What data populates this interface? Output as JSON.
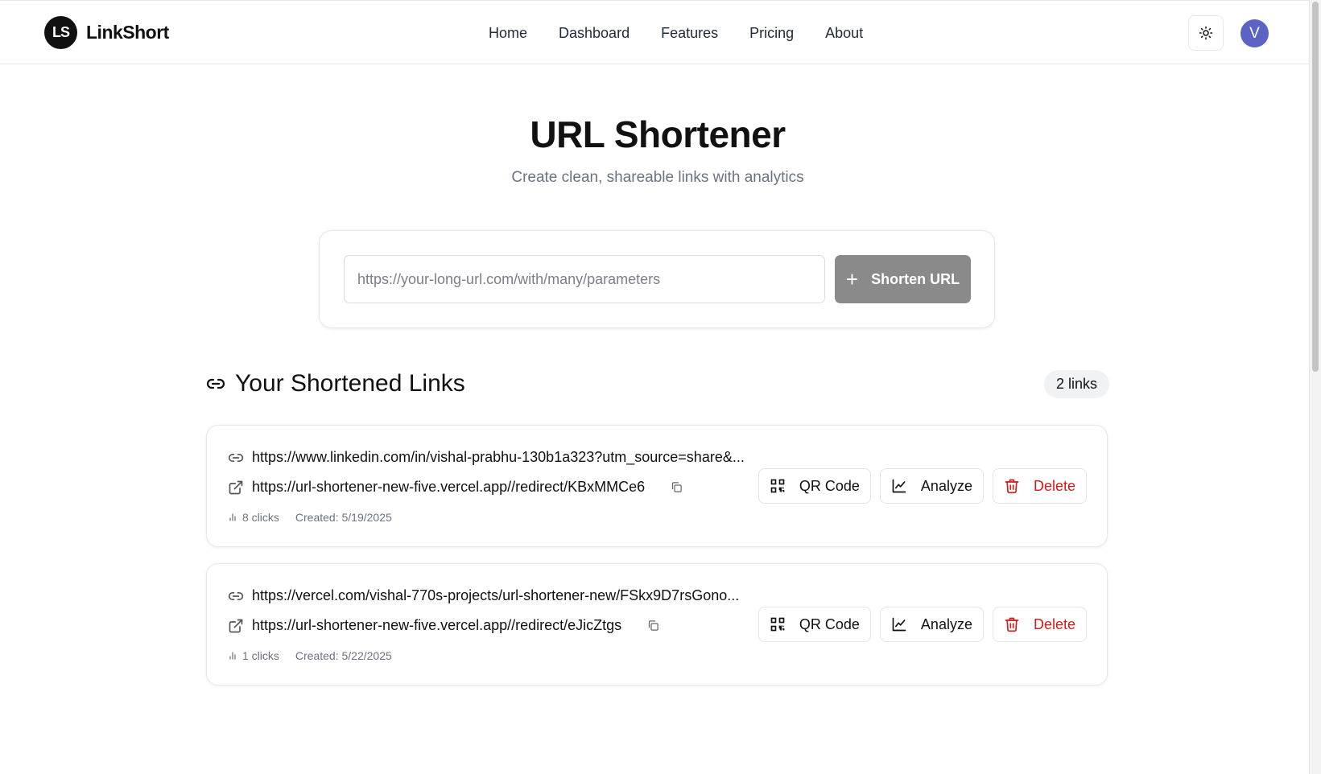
{
  "header": {
    "logo_text": "LS",
    "brand": "LinkShort",
    "nav": [
      "Home",
      "Dashboard",
      "Features",
      "Pricing",
      "About"
    ],
    "avatar_initial": "V"
  },
  "hero": {
    "title": "URL Shortener",
    "subtitle": "Create clean, shareable links with analytics"
  },
  "shorten": {
    "placeholder": "https://your-long-url.com/with/many/parameters",
    "value": "",
    "button_label": "Shorten URL"
  },
  "links_section": {
    "title": "Your Shortened Links",
    "count_label": "2 links"
  },
  "links": [
    {
      "original": "https://www.linkedin.com/in/vishal-prabhu-130b1a323?utm_source=share&...",
      "short": "https://url-shortener-new-five.vercel.app//redirect/KBxMMCe6",
      "clicks": "8 clicks",
      "created": "Created: 5/19/2025",
      "qr_label": "QR Code",
      "analyze_label": "Analyze",
      "delete_label": "Delete"
    },
    {
      "original": "https://vercel.com/vishal-770s-projects/url-shortener-new/FSkx9D7rsGono...",
      "short": "https://url-shortener-new-five.vercel.app//redirect/eJicZtgs",
      "clicks": "1 clicks",
      "created": "Created: 5/22/2025",
      "qr_label": "QR Code",
      "analyze_label": "Analyze",
      "delete_label": "Delete"
    }
  ],
  "colors": {
    "button_gray": "#8a8a8a",
    "avatar": "#5b63c4",
    "danger": "#d11a1a",
    "muted_text": "#6b7280"
  },
  "icons": {
    "theme": "sun-icon",
    "section": "link-icon",
    "original": "link-icon",
    "short": "external-link-icon",
    "copy": "copy-icon",
    "clicks": "bar-chart-icon",
    "qr": "qr-code-icon",
    "analyze": "line-chart-icon",
    "delete": "trash-icon"
  }
}
